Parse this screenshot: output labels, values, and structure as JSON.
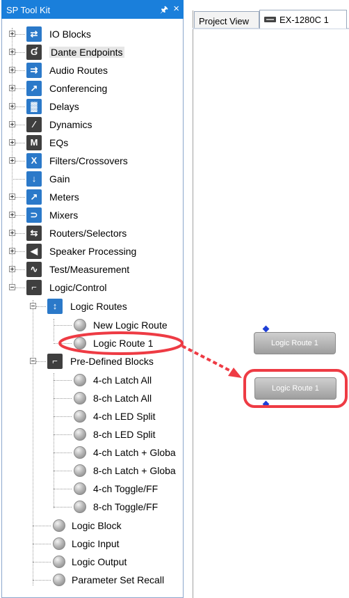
{
  "toolkit": {
    "title": "SP Tool Kit",
    "pin": "X",
    "close": "×",
    "items": [
      {
        "label": "IO Blocks"
      },
      {
        "label": "Dante Endpoints"
      },
      {
        "label": "Audio Routes"
      },
      {
        "label": "Conferencing"
      },
      {
        "label": "Delays"
      },
      {
        "label": "Dynamics"
      },
      {
        "label": "EQs"
      },
      {
        "label": "Filters/Crossovers"
      },
      {
        "label": "Gain"
      },
      {
        "label": "Meters"
      },
      {
        "label": "Mixers"
      },
      {
        "label": "Routers/Selectors"
      },
      {
        "label": "Speaker Processing"
      },
      {
        "label": "Test/Measurement"
      },
      {
        "label": "Logic/Control"
      },
      {
        "label": "Logic Routes"
      },
      {
        "label": "New Logic Route"
      },
      {
        "label": "Logic Route 1"
      },
      {
        "label": "Pre-Defined Blocks"
      },
      {
        "label": "4-ch Latch All"
      },
      {
        "label": "8-ch Latch All"
      },
      {
        "label": "4-ch LED Split"
      },
      {
        "label": "8-ch LED Split"
      },
      {
        "label": "4-ch Latch + Globa"
      },
      {
        "label": "8-ch Latch + Globa"
      },
      {
        "label": "4-ch Toggle/FF"
      },
      {
        "label": "8-ch Toggle/FF"
      },
      {
        "label": "Logic Block"
      },
      {
        "label": "Logic Input"
      },
      {
        "label": "Logic Output"
      },
      {
        "label": "Parameter Set Recall"
      }
    ]
  },
  "tabs": [
    {
      "label": "Project View"
    },
    {
      "label": "EX-1280C 1"
    }
  ],
  "canvas": {
    "block_top_label": "Logic Route 1",
    "block_dragged_label": "Logic Route 1"
  },
  "colors": {
    "header": "#1a7fdb",
    "annotation": "#ee3b44",
    "pin_dot": "#1e3fd6"
  },
  "icons": {
    "tree_leaf": "ball-icon"
  }
}
